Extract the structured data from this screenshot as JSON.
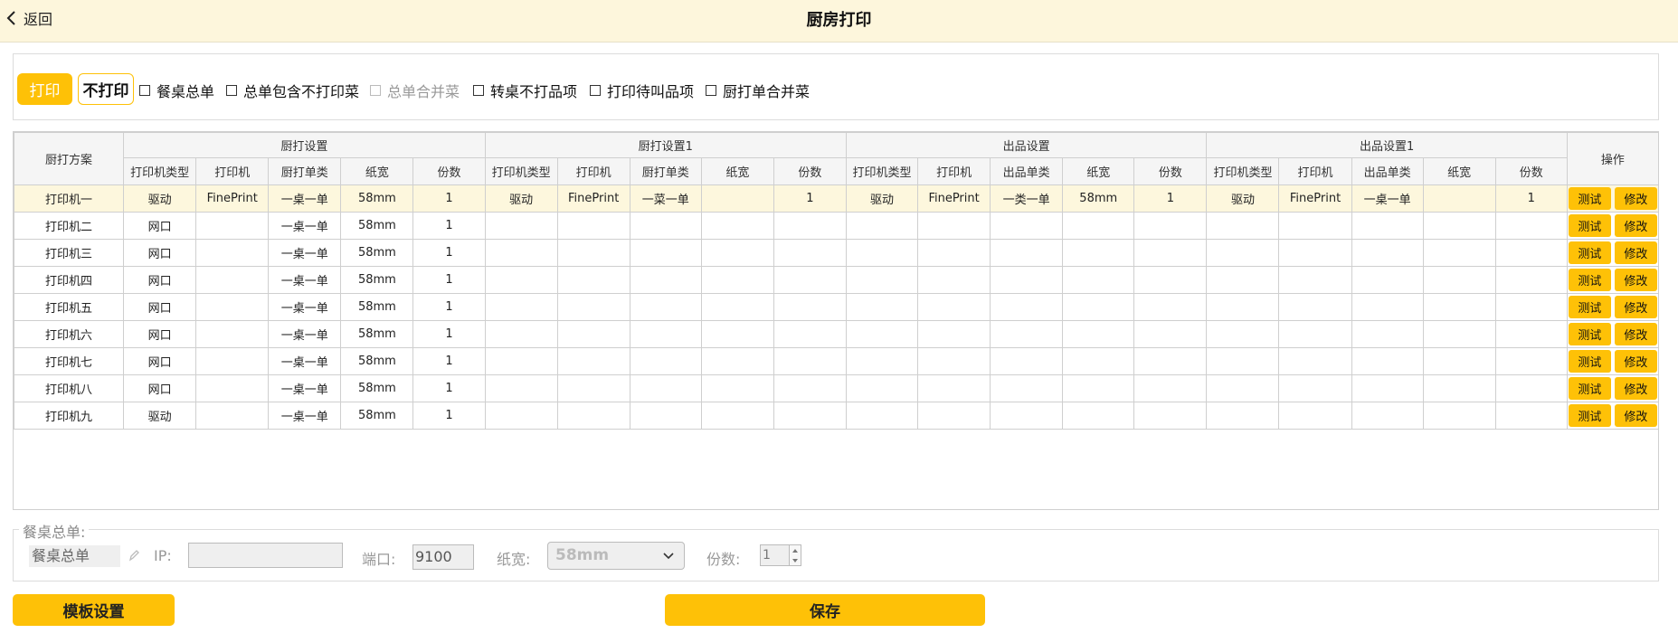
{
  "header": {
    "back_label": "返回",
    "title": "厨房打印"
  },
  "toolbar": {
    "print_label": "打印",
    "noprint_label": "不打印",
    "options": [
      {
        "label": "餐桌总单",
        "checked": false,
        "disabled": false
      },
      {
        "label": "总单包含不打印菜",
        "checked": false,
        "disabled": false
      },
      {
        "label": "总单合并菜",
        "checked": false,
        "disabled": true
      },
      {
        "label": "转桌不打品项",
        "checked": false,
        "disabled": false
      },
      {
        "label": "打印待叫品项",
        "checked": false,
        "disabled": false
      },
      {
        "label": "厨打单合并菜",
        "checked": false,
        "disabled": false
      }
    ]
  },
  "table": {
    "col_scheme": "厨打方案",
    "col_ops": "操作",
    "groups": [
      "厨打设置",
      "厨打设置1",
      "出品设置",
      "出品设置1"
    ],
    "subheaders": [
      [
        "打印机类型",
        "打印机",
        "厨打单类",
        "纸宽",
        "份数"
      ],
      [
        "打印机类型",
        "打印机",
        "厨打单类",
        "纸宽",
        "份数"
      ],
      [
        "打印机类型",
        "打印机",
        "出品单类",
        "纸宽",
        "份数"
      ],
      [
        "打印机类型",
        "打印机",
        "出品单类",
        "纸宽",
        "份数"
      ]
    ],
    "rows": [
      {
        "name": "打印机一",
        "selected": true,
        "cells": [
          "驱动",
          "FinePrint",
          "一桌一单",
          "58mm",
          "1",
          "驱动",
          "FinePrint",
          "一菜一单",
          "",
          "1",
          "驱动",
          "FinePrint",
          "一类一单",
          "58mm",
          "1",
          "驱动",
          "FinePrint",
          "一桌一单",
          "",
          "1"
        ]
      },
      {
        "name": "打印机二",
        "selected": false,
        "cells": [
          "网口",
          "",
          "一桌一单",
          "58mm",
          "1",
          "",
          "",
          "",
          "",
          "",
          "",
          "",
          "",
          "",
          "",
          "",
          "",
          "",
          "",
          ""
        ]
      },
      {
        "name": "打印机三",
        "selected": false,
        "cells": [
          "网口",
          "",
          "一桌一单",
          "58mm",
          "1",
          "",
          "",
          "",
          "",
          "",
          "",
          "",
          "",
          "",
          "",
          "",
          "",
          "",
          "",
          ""
        ]
      },
      {
        "name": "打印机四",
        "selected": false,
        "cells": [
          "网口",
          "",
          "一桌一单",
          "58mm",
          "1",
          "",
          "",
          "",
          "",
          "",
          "",
          "",
          "",
          "",
          "",
          "",
          "",
          "",
          "",
          ""
        ]
      },
      {
        "name": "打印机五",
        "selected": false,
        "cells": [
          "网口",
          "",
          "一桌一单",
          "58mm",
          "1",
          "",
          "",
          "",
          "",
          "",
          "",
          "",
          "",
          "",
          "",
          "",
          "",
          "",
          "",
          ""
        ]
      },
      {
        "name": "打印机六",
        "selected": false,
        "cells": [
          "网口",
          "",
          "一桌一单",
          "58mm",
          "1",
          "",
          "",
          "",
          "",
          "",
          "",
          "",
          "",
          "",
          "",
          "",
          "",
          "",
          "",
          ""
        ]
      },
      {
        "name": "打印机七",
        "selected": false,
        "cells": [
          "网口",
          "",
          "一桌一单",
          "58mm",
          "1",
          "",
          "",
          "",
          "",
          "",
          "",
          "",
          "",
          "",
          "",
          "",
          "",
          "",
          "",
          ""
        ]
      },
      {
        "name": "打印机八",
        "selected": false,
        "cells": [
          "网口",
          "",
          "一桌一单",
          "58mm",
          "1",
          "",
          "",
          "",
          "",
          "",
          "",
          "",
          "",
          "",
          "",
          "",
          "",
          "",
          "",
          ""
        ]
      },
      {
        "name": "打印机九",
        "selected": false,
        "cells": [
          "驱动",
          "",
          "一桌一单",
          "58mm",
          "1",
          "",
          "",
          "",
          "",
          "",
          "",
          "",
          "",
          "",
          "",
          "",
          "",
          "",
          "",
          ""
        ]
      }
    ],
    "test_label": "测试",
    "edit_label": "修改"
  },
  "summary": {
    "legend": "餐桌总单:",
    "name_value": "餐桌总单",
    "ip_label": "IP:",
    "ip_value": "",
    "port_label": "端口:",
    "port_value": "9100",
    "paper_label": "纸宽:",
    "paper_value": "58mm",
    "copies_label": "份数:",
    "copies_value": "1"
  },
  "footer": {
    "template_label": "模板设置",
    "save_label": "保存"
  },
  "colors": {
    "accent": "#fec107",
    "header_bg": "#fdf6dc",
    "selected_row": "#fdf7dd"
  }
}
